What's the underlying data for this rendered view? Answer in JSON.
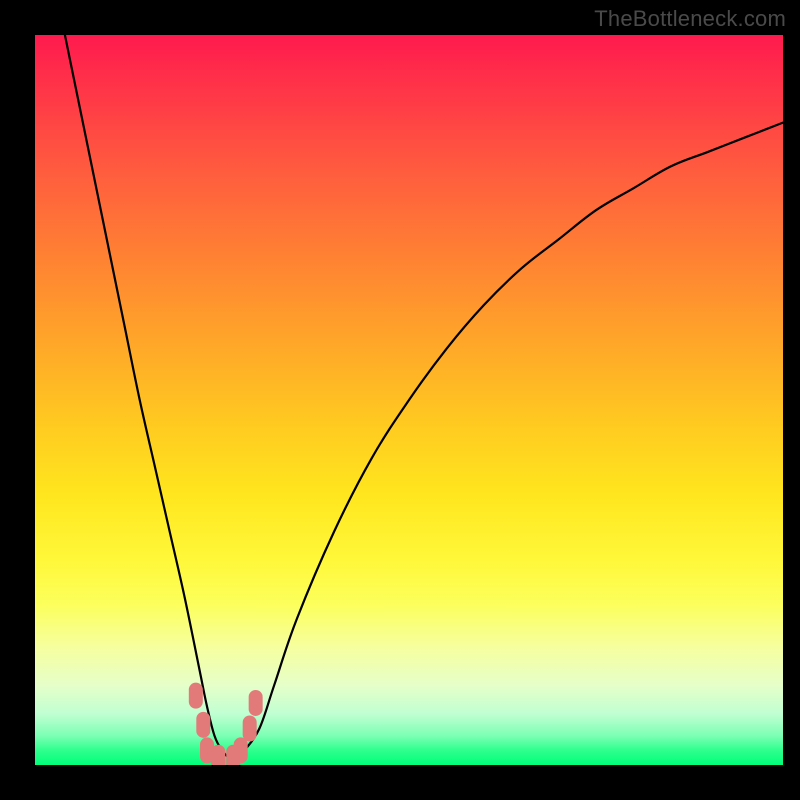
{
  "watermark": "TheBottleneck.com",
  "chart_data": {
    "type": "line",
    "title": "",
    "xlabel": "",
    "ylabel": "",
    "xlim": [
      0,
      100
    ],
    "ylim": [
      0,
      100
    ],
    "grid": false,
    "series": [
      {
        "name": "bottleneck-curve",
        "x": [
          4,
          6,
          8,
          10,
          12,
          14,
          16,
          18,
          20,
          22,
          23,
          24,
          25,
          26,
          27,
          28,
          30,
          32,
          35,
          40,
          45,
          50,
          55,
          60,
          65,
          70,
          75,
          80,
          85,
          90,
          95,
          100
        ],
        "values": [
          100,
          90,
          80,
          70,
          60,
          50,
          41,
          32,
          23,
          13,
          8,
          4,
          2,
          1,
          1,
          2,
          5,
          11,
          20,
          32,
          42,
          50,
          57,
          63,
          68,
          72,
          76,
          79,
          82,
          84,
          86,
          88
        ]
      }
    ],
    "markers": [
      {
        "x": 21.5,
        "y": 9.5
      },
      {
        "x": 22.5,
        "y": 5.5
      },
      {
        "x": 23.0,
        "y": 2.0
      },
      {
        "x": 24.5,
        "y": 1.0
      },
      {
        "x": 26.5,
        "y": 1.0
      },
      {
        "x": 27.5,
        "y": 2.0
      },
      {
        "x": 28.7,
        "y": 5.0
      },
      {
        "x": 29.5,
        "y": 8.5
      }
    ],
    "gradient_stops": [
      {
        "pct": 0,
        "color": "#ff1a4e"
      },
      {
        "pct": 50,
        "color": "#ffcc20"
      },
      {
        "pct": 80,
        "color": "#fcff5c"
      },
      {
        "pct": 100,
        "color": "#00ff7a"
      }
    ]
  }
}
